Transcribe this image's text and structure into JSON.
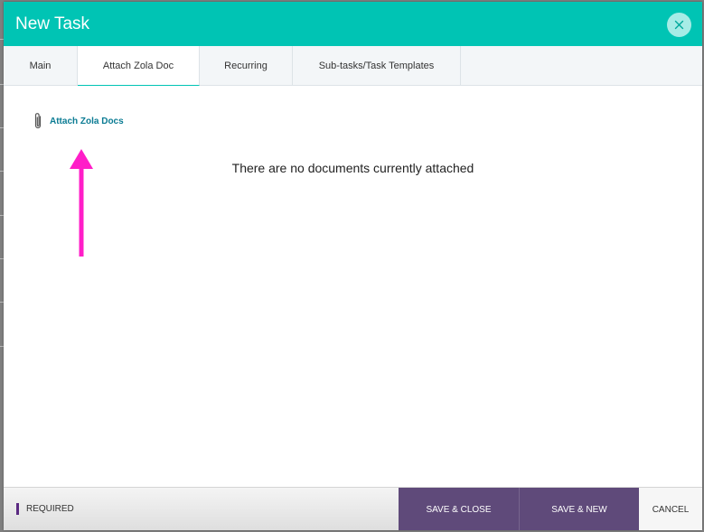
{
  "modal": {
    "title": "New Task",
    "close_icon": "close-icon"
  },
  "tabs": [
    {
      "label": "Main",
      "active": false
    },
    {
      "label": "Attach Zola Doc",
      "active": true
    },
    {
      "label": "Recurring",
      "active": false
    },
    {
      "label": "Sub-tasks/Task Templates",
      "active": false
    }
  ],
  "content": {
    "attach_link_label": "Attach Zola Docs",
    "attach_icon": "paperclip-icon",
    "empty_message": "There are no documents currently attached",
    "annotation_icon": "arrow-up-icon"
  },
  "footer": {
    "required_label": "REQUIRED",
    "save_close_label": "SAVE & CLOSE",
    "save_new_label": "SAVE & NEW",
    "cancel_label": "CANCEL"
  },
  "colors": {
    "header": "#00c4b4",
    "primary_button": "#5f4a7a",
    "link": "#0a7b93",
    "annotation_arrow": "#ff1ec8",
    "required_bar": "#5b2a82"
  }
}
